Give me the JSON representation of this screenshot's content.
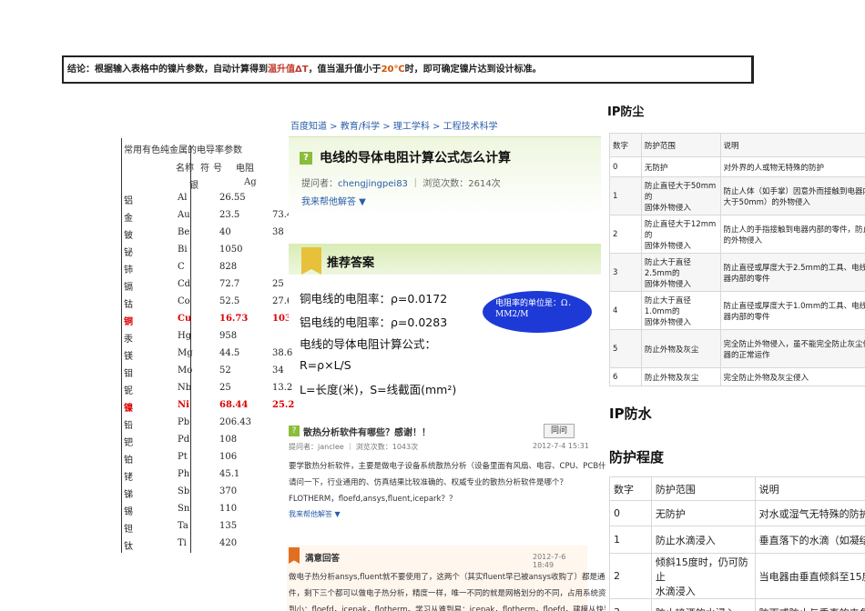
{
  "conclusion": {
    "prefix": "结论：根据输入表格中的镍片参数，自动计算得到",
    "hl1": "温升值ΔT",
    "mid": "，值当温升值小于",
    "hl2": "20℃",
    "suffix": "时，即可确定镍片达到设计标准。"
  },
  "resistivity": {
    "title": "常用有色纯金属的电导率参数",
    "header1": [
      "名称",
      "符",
      "号",
      "电阻"
    ],
    "header2": [
      "银",
      "Ag"
    ],
    "rows": [
      {
        "name": "铝",
        "sym": "Al",
        "rho": "26.55",
        "extra": "",
        "hot": false
      },
      {
        "name": "金",
        "sym": "Au",
        "rho": "23.5",
        "extra": "73.4",
        "hot": false
      },
      {
        "name": "铍",
        "sym": "Be",
        "rho": "40",
        "extra": "38",
        "hot": false
      },
      {
        "name": "铋",
        "sym": "Bi",
        "rho": "1050",
        "extra": "",
        "hot": false
      },
      {
        "name": "铈",
        "sym": "C",
        "rho": "828",
        "extra": "",
        "hot": false
      },
      {
        "name": "镉",
        "sym": "Cd",
        "rho": "72.7",
        "extra": "25",
        "hot": false
      },
      {
        "name": "钴",
        "sym": "Co",
        "rho": "52.5",
        "extra": "27.6",
        "hot": false
      },
      {
        "name": "铜",
        "sym": "Cu",
        "rho": "16.73",
        "extra": "103.0",
        "hot": true
      },
      {
        "name": "汞",
        "sym": "Hg",
        "rho": "958",
        "extra": "",
        "hot": false
      },
      {
        "name": "镁",
        "sym": "Mg",
        "rho": "44.5",
        "extra": "38.6",
        "hot": false
      },
      {
        "name": "钼",
        "sym": "Mo",
        "rho": "52",
        "extra": "34",
        "hot": false
      },
      {
        "name": "铌",
        "sym": "Nb",
        "rho": "25",
        "extra": "13.2",
        "hot": false
      },
      {
        "name": "镍",
        "sym": "Ni",
        "rho": "68.44",
        "extra": "25.2",
        "hot": true
      },
      {
        "name": "铅",
        "sym": "Pb",
        "rho": "206.43",
        "extra": "",
        "hot": false
      },
      {
        "name": "钯",
        "sym": "Pd",
        "rho": "108",
        "extra": "",
        "hot": false
      },
      {
        "name": "铂",
        "sym": "Pt",
        "rho": "106",
        "extra": "",
        "hot": false
      },
      {
        "name": "铑",
        "sym": "Ph",
        "rho": "45.1",
        "extra": "",
        "hot": false
      },
      {
        "name": "锑",
        "sym": "Sb",
        "rho": "370",
        "extra": "",
        "hot": false
      },
      {
        "name": "锡",
        "sym": "Sn",
        "rho": "110",
        "extra": "",
        "hot": false
      },
      {
        "name": "钽",
        "sym": "Ta",
        "rho": "135",
        "extra": "",
        "hot": false
      },
      {
        "name": "钛",
        "sym": "Ti",
        "rho": "420",
        "extra": "",
        "hot": false
      }
    ]
  },
  "zhidao": {
    "breadcrumb": "百度知道 > 教育/科学 > 理工学科 > 工程技术科学",
    "question_title": "电线的导体电阻计算公式怎么计算",
    "asker_label": "提问者：",
    "asker": "chengjingpei83",
    "views": "浏览次数：2614次",
    "help": "我来帮他解答 ▼",
    "rec_title": "推荐答案",
    "answer_lines": [
      "铜电线的电阻率：ρ=0.0172",
      "铝电线的电阻率：ρ=0.0283",
      "电线的导体电阻计算公式：",
      "R=ρ×L/S",
      "L=长度(米)，S=线截面(mm²)"
    ],
    "ellipse_note": "电阻率的单位是：Ω．MM2/M",
    "q2": {
      "title": "散热分析软件有哪些？感谢！！",
      "button": "同问",
      "meta": "提问者：janclee ｜ 浏览次数：1043次",
      "date": "2012-7-4 15:31",
      "lines": [
        "要学散热分析软件，主要是做电子设备系统散热分析（设备里面有风扇、电容、CPU、PCB什么的），",
        "请问一下，行业通用的、仿真结果比较准确的、权威专业的散热分析软件是哪个？",
        "FLOTHERM，floefd,ansys,fluent,icepark？？"
      ],
      "help": "我来帮他解答 ▼"
    },
    "satisfied": {
      "title": "满意回答",
      "date": "2012-7-6 18:49",
      "lines": [
        "做电子热分析ansys,fluent就不要使用了，这两个（其实fluent早已被ansys收购了）都是通用型分析软",
        "件，剩下三个都可以做电子热分析，精度一样，唯一不同的就是网格划分的不同，占用系统资源从大",
        "到小：floefd，icepak，flotherm。学习从难到易：icepak，flotherm，floefd，建模从快到慢：floefd，"
      ]
    }
  },
  "ip_dust": {
    "title": "IP防尘",
    "headers": [
      "数字",
      "防护范围",
      "说明"
    ],
    "rows": [
      [
        "0",
        "无防护",
        "对外界的人或物无特殊的防护"
      ],
      [
        "1",
        "防止直径大于50mm的\n固体外物侵入",
        "防止人体（如手掌）因意外而接触到电器内\n大于50mm）的外物侵入"
      ],
      [
        "2",
        "防止直径大于12mm的\n固体外物侵入",
        "防止人的手指接触到电器内部的零件，防止\n的外物侵入"
      ],
      [
        "3",
        "防止大于直径2.5mm的\n固体外物侵入",
        "防止直径或厚度大于2.5mm的工具、电线及\n器内部的零件"
      ],
      [
        "4",
        "防止大于直径1.0mm的\n固体外物侵入",
        "防止直径或厚度大于1.0mm的工具、电线及\n器内部的零件"
      ],
      [
        "5",
        "防止外物及灰尘",
        "完全防止外物侵入，虽不能完全防止灰尘侵\n器的正常运作"
      ],
      [
        "6",
        "防止外物及灰尘",
        "完全防止外物及灰尘侵入"
      ]
    ]
  },
  "ip_water": {
    "title": "IP防水",
    "subtitle": "防护程度",
    "headers": [
      "数字",
      "防护范围",
      "说明"
    ],
    "rows": [
      [
        "0",
        "无防护",
        "对水或湿气无特殊的防护"
      ],
      [
        "1",
        "防止水滴浸入",
        "垂直落下的水滴（如凝结水"
      ],
      [
        "2",
        "倾斜15度时，仍可防止\n水滴浸入",
        "当电器由垂直倾斜至15度时"
      ],
      [
        "3",
        "防止喷洒的水浸入",
        "防雨或防止与垂直的夹角小"
      ]
    ]
  }
}
